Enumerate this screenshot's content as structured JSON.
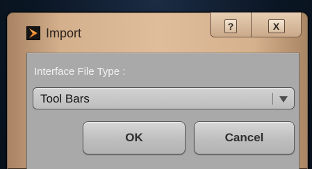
{
  "window": {
    "title": "Import",
    "help_label": "?",
    "close_label": "X"
  },
  "form": {
    "field_label": "Interface File Type :",
    "select_value": "Tool Bars"
  },
  "buttons": {
    "ok_label": "OK",
    "cancel_label": "Cancel"
  },
  "colors": {
    "frame": "#d6b18e",
    "panel": "#a9a9a9",
    "button": "#c4c4c4",
    "desktop": "#0c1827"
  }
}
